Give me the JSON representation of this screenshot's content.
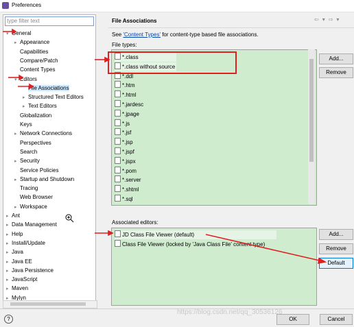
{
  "window": {
    "title": "Preferences"
  },
  "filter": {
    "placeholder": "type filter text"
  },
  "tree": [
    {
      "label": "General",
      "indent": 0,
      "tw": "▾"
    },
    {
      "label": "Appearance",
      "indent": 1,
      "tw": "▸"
    },
    {
      "label": "Capabilities",
      "indent": 1,
      "tw": ""
    },
    {
      "label": "Compare/Patch",
      "indent": 1,
      "tw": ""
    },
    {
      "label": "Content Types",
      "indent": 1,
      "tw": ""
    },
    {
      "label": "Editors",
      "indent": 1,
      "tw": "▾"
    },
    {
      "label": "File Associations",
      "indent": 2,
      "tw": "",
      "selected": true
    },
    {
      "label": "Structured Text Editors",
      "indent": 2,
      "tw": "▸"
    },
    {
      "label": "Text Editors",
      "indent": 2,
      "tw": "▸"
    },
    {
      "label": "Globalization",
      "indent": 1,
      "tw": ""
    },
    {
      "label": "Keys",
      "indent": 1,
      "tw": ""
    },
    {
      "label": "Network Connections",
      "indent": 1,
      "tw": "▸"
    },
    {
      "label": "Perspectives",
      "indent": 1,
      "tw": ""
    },
    {
      "label": "Search",
      "indent": 1,
      "tw": ""
    },
    {
      "label": "Security",
      "indent": 1,
      "tw": "▸"
    },
    {
      "label": "Service Policies",
      "indent": 1,
      "tw": ""
    },
    {
      "label": "Startup and Shutdown",
      "indent": 1,
      "tw": "▸"
    },
    {
      "label": "Tracing",
      "indent": 1,
      "tw": ""
    },
    {
      "label": "Web Browser",
      "indent": 1,
      "tw": ""
    },
    {
      "label": "Workspace",
      "indent": 1,
      "tw": "▸"
    },
    {
      "label": "Ant",
      "indent": 0,
      "tw": "▸"
    },
    {
      "label": "Data Management",
      "indent": 0,
      "tw": "▸"
    },
    {
      "label": "Help",
      "indent": 0,
      "tw": "▸"
    },
    {
      "label": "Install/Update",
      "indent": 0,
      "tw": "▸"
    },
    {
      "label": "Java",
      "indent": 0,
      "tw": "▸"
    },
    {
      "label": "Java EE",
      "indent": 0,
      "tw": "▸"
    },
    {
      "label": "Java Persistence",
      "indent": 0,
      "tw": "▸"
    },
    {
      "label": "JavaScript",
      "indent": 0,
      "tw": "▸"
    },
    {
      "label": "Maven",
      "indent": 0,
      "tw": "▸"
    },
    {
      "label": "Mylyn",
      "indent": 0,
      "tw": "▸"
    }
  ],
  "page": {
    "title": "File Associations",
    "desc_pre": "See ",
    "desc_link": "'Content Types'",
    "desc_post": " for content-type based file associations.",
    "file_types_label": "File types:",
    "assoc_label": "Associated editors:"
  },
  "file_types": [
    "*.class",
    "*.class without source",
    "*.ddl",
    "*.htm",
    "*.html",
    "*.jardesc",
    "*.jpage",
    "*.js",
    "*.jsf",
    "*.jsp",
    "*.jspf",
    "*.jspx",
    "*.pom",
    "*.server",
    "*.shtml",
    "*.sql"
  ],
  "editors": [
    "JD Class File Viewer (default)",
    "Class File Viewer (locked by 'Java Class File' content type)"
  ],
  "buttons": {
    "add_types": "Add...",
    "remove_types": "Remove",
    "add_editor": "Add...",
    "remove_editor": "Remove",
    "default": "Default",
    "ok": "OK",
    "cancel": "Cancel"
  },
  "nav": {
    "back": "⇦",
    "dropdown": "▾",
    "forward": "⇨",
    "menu": "▾"
  },
  "watermark": "https://blog.csdn.net/qq_30536126"
}
